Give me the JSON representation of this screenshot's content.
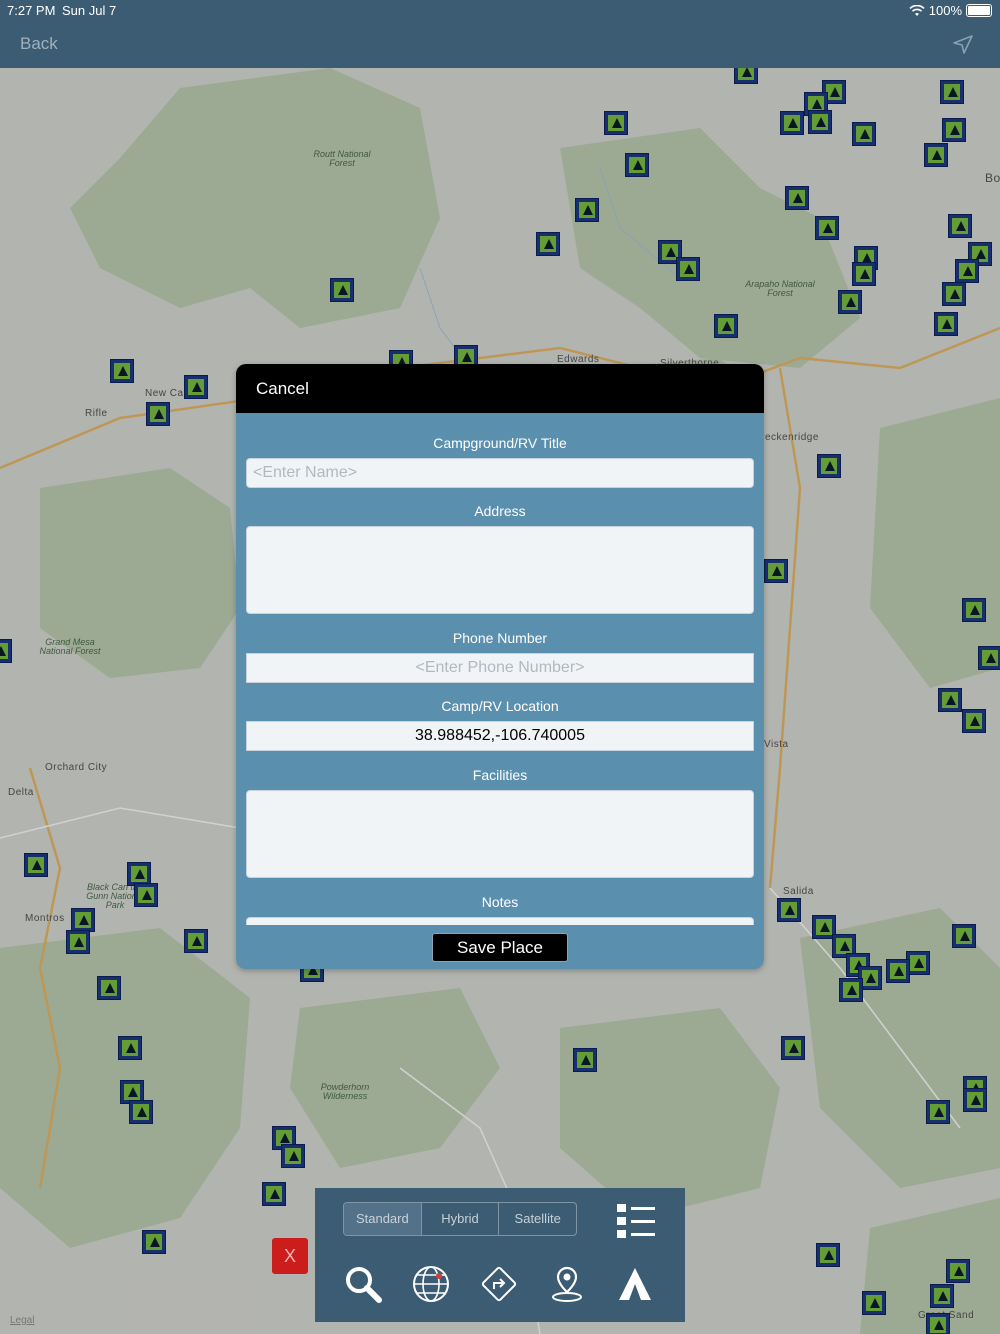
{
  "status_bar": {
    "time": "7:27 PM",
    "date": "Sun Jul 7",
    "battery": "100%"
  },
  "nav": {
    "back_label": "Back"
  },
  "map": {
    "labels": {
      "routt": "Routt National Forest",
      "arapaho": "Arapaho National Forest",
      "grand_mesa": "Grand Mesa National Forest",
      "powderhorn": "Powderhorn Wilderness",
      "black_canyon": "Black Can the Gunn National Park"
    },
    "towns": {
      "rifle": "Rifle",
      "new_castle": "New Ca",
      "edwards": "Edwards",
      "breckenridge": "Breckenridge",
      "orchard_city": "Orchard City",
      "delta": "Delta",
      "montrose": "Montros",
      "salida": "Salida",
      "vista": "Vista",
      "silverthorne": "Silverthorne",
      "great_sand": "Great Sand",
      "bo": "Bo"
    },
    "legal_label": "Legal"
  },
  "modal": {
    "cancel_label": "Cancel",
    "fields": {
      "title_label": "Campground/RV Title",
      "title_placeholder": "<Enter Name>",
      "address_label": "Address",
      "address_value": "",
      "phone_label": "Phone Number",
      "phone_placeholder": "<Enter Phone Number>",
      "location_label": "Camp/RV Location",
      "location_value": "38.988452,-106.740005",
      "facilities_label": "Facilities",
      "facilities_value": "",
      "notes_label": "Notes"
    },
    "save_label": "Save Place"
  },
  "toolbar": {
    "map_types": [
      "Standard",
      "Hybrid",
      "Satellite"
    ],
    "selected_map_type": "Standard",
    "icons": [
      "list-icon",
      "search-icon",
      "globe-icon",
      "directions-icon",
      "location-pin-icon",
      "tent-icon"
    ]
  },
  "close_label": "X"
}
